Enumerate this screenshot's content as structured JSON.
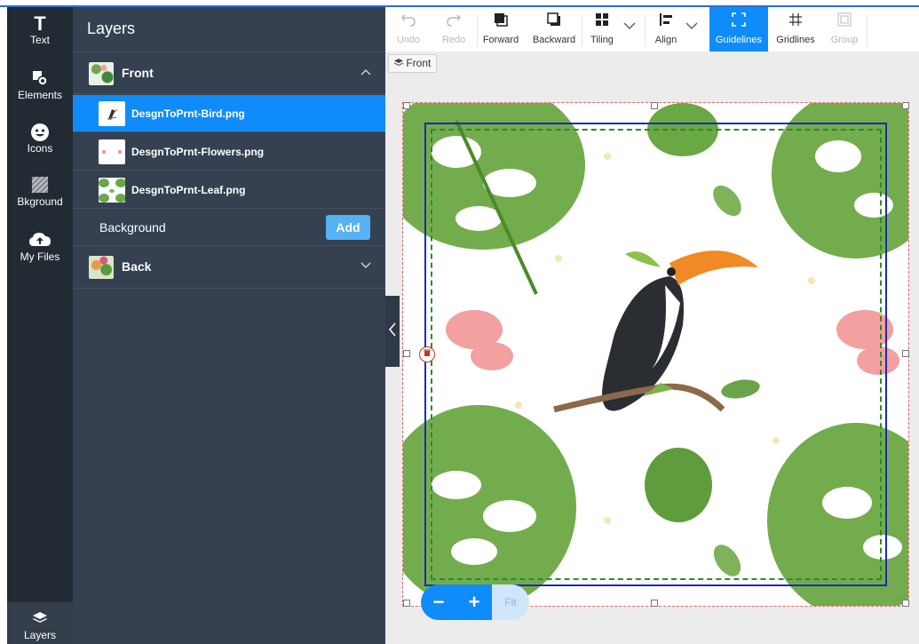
{
  "rail": {
    "items": [
      {
        "label": "Text",
        "icon": "text-icon"
      },
      {
        "label": "Elements",
        "icon": "elements-icon"
      },
      {
        "label": "Icons",
        "icon": "smiley-icon"
      },
      {
        "label": "Bkground",
        "icon": "background-icon"
      },
      {
        "label": "My Files",
        "icon": "cloud-upload-icon"
      }
    ],
    "layers_label": "Layers"
  },
  "panel": {
    "title": "Layers",
    "groups": [
      {
        "name": "Front",
        "expanded": true
      },
      {
        "name": "Back",
        "expanded": false
      }
    ],
    "layers": [
      {
        "name": "DesgnToPrnt-Bird.png",
        "selected": true
      },
      {
        "name": "DesgnToPrnt-Flowers.png",
        "selected": false
      },
      {
        "name": "DesgnToPrnt-Leaf.png",
        "selected": false
      }
    ],
    "background": {
      "label": "Background",
      "add_label": "Add"
    }
  },
  "toolbar": {
    "undo": "Undo",
    "redo": "Redo",
    "forward": "Forward",
    "backward": "Backward",
    "tiling": "Tiling",
    "align": "Align",
    "guidelines": "Guidelines",
    "gridlines": "Gridlines",
    "group": "Group"
  },
  "canvas": {
    "active_group_chip": "Front"
  },
  "zoom": {
    "minus": "−",
    "plus": "+",
    "fit": "Fit"
  },
  "colors": {
    "accent": "#0f8cfa",
    "rail_bg": "#222b33",
    "panel_bg": "#354150",
    "guide_blue": "#1c2bb4",
    "guide_green": "#2d8a2d"
  }
}
